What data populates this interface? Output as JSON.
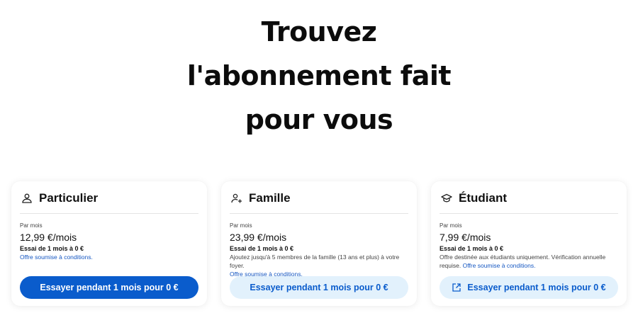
{
  "headline": {
    "line1": "Trouvez",
    "line2": "l'abonnement fait",
    "line3": "pour vous"
  },
  "plans": [
    {
      "title": "Particulier",
      "icon": "person-icon",
      "per_month_label": "Par mois",
      "price": "12,99 €/mois",
      "trial": "Essai de 1 mois à 0 €",
      "description": "",
      "conditions_link": "Offre soumise à conditions.",
      "button_label": "Essayer pendant 1 mois pour 0 €"
    },
    {
      "title": "Famille",
      "icon": "person-add-icon",
      "per_month_label": "Par mois",
      "price": "23,99 €/mois",
      "trial": "Essai de 1 mois à 0 €",
      "description": "Ajoutez jusqu'à 5 membres de la famille (13 ans et plus) à votre foyer.",
      "conditions_link": "Offre soumise à conditions.",
      "button_label": "Essayer pendant 1 mois pour 0 €"
    },
    {
      "title": "Étudiant",
      "icon": "graduation-cap-icon",
      "per_month_label": "Par mois",
      "price": "7,99 €/mois",
      "trial": "Essai de 1 mois à 0 €",
      "description": "Offre destinée aux étudiants uniquement. Vérification annuelle requise.",
      "conditions_link": "Offre soumise à conditions.",
      "button_label": "Essayer pendant 1 mois pour 0 €",
      "button_icon": "external-link-icon"
    }
  ],
  "colors": {
    "primary": "#0a5ccc",
    "secondary_bg": "#e2f1fc",
    "link": "#1557c2"
  }
}
